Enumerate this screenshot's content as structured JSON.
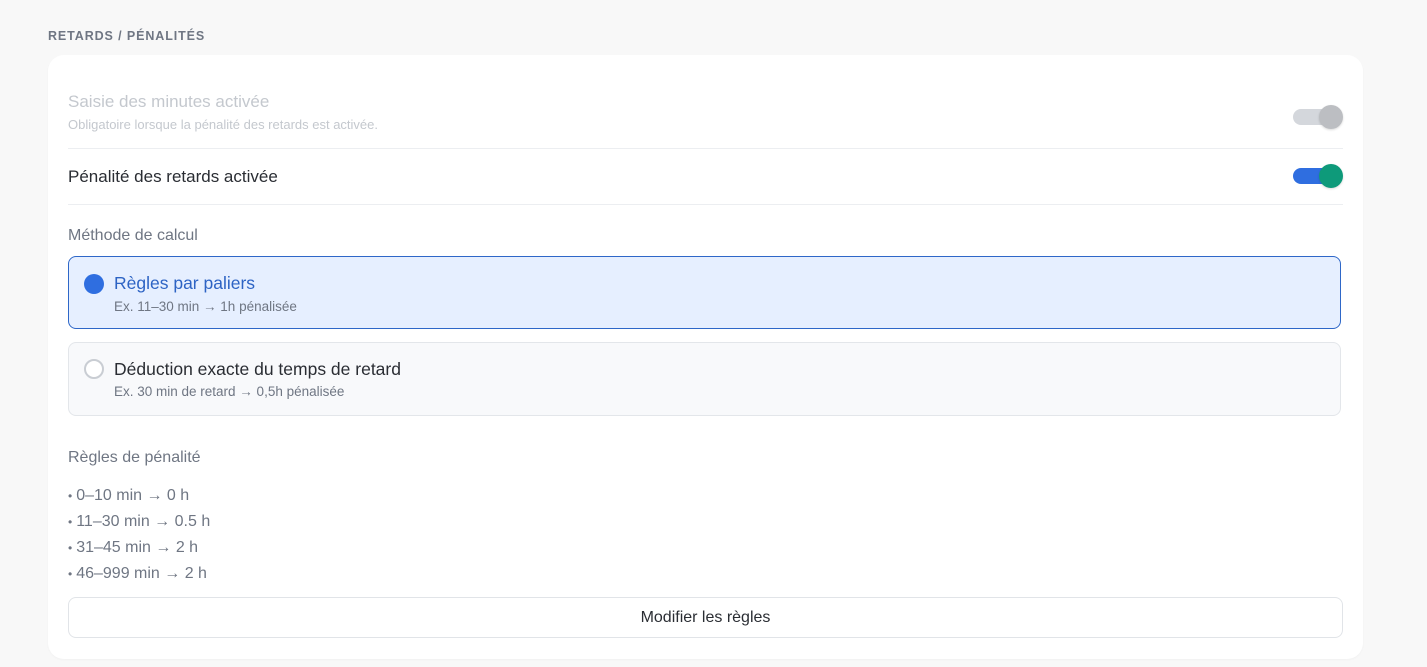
{
  "section": {
    "title": "RETARDS / PÉNALITÉS"
  },
  "settings": {
    "minutes_entry": {
      "title": "Saisie des minutes activée",
      "subtitle": "Obligatoire lorsque la pénalité des retards est activée.",
      "enabled": true,
      "disabled": true
    },
    "late_penalty": {
      "title": "Pénalité des retards activée",
      "enabled": true
    }
  },
  "calculation": {
    "label": "Méthode de calcul",
    "selected": "tiers",
    "options": [
      {
        "id": "tiers",
        "title": "Règles par paliers",
        "example": "Ex. 11–30 min → 1h pénalisée"
      },
      {
        "id": "exact",
        "title": "Déduction exacte du temps de retard",
        "example": "Ex. 30 min de retard → 0,5h pénalisée"
      }
    ]
  },
  "rules": {
    "label": "Règles de pénalité",
    "bullet": "•",
    "items": [
      "0–10 min → 0 h",
      "11–30 min → 0.5 h",
      "31–45 min → 2 h",
      "46–999 min → 2 h"
    ],
    "modify_button": "Modifier les règles"
  },
  "colors": {
    "accent": "#2f6ee0",
    "toggle_knob_on": "#0e9a7a",
    "selected_option_bg": "#e6efff",
    "selected_option_border": "#2e67c8"
  }
}
